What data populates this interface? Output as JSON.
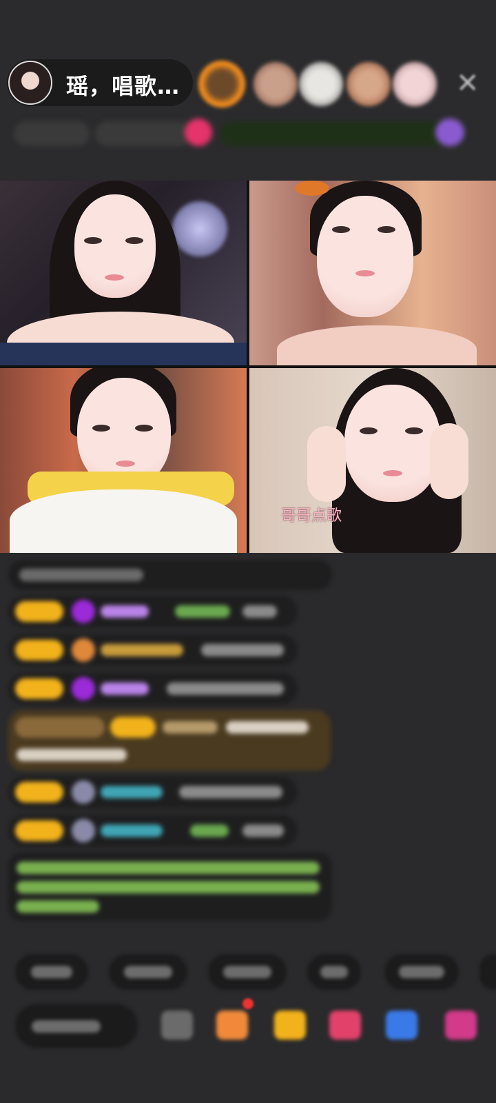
{
  "header": {
    "host_name": "瑶，唱歌…"
  },
  "video": {
    "caption": "哥哥点歌"
  }
}
